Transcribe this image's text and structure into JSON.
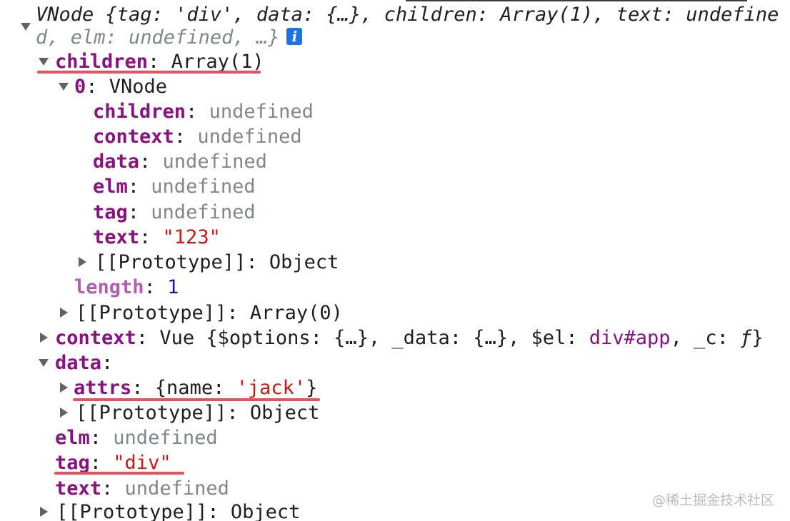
{
  "summary": {
    "line1": "VNode {tag: 'div', data: {…}, children: Array(1), text: undefine",
    "line2": "d, elm: undefined, …}",
    "info_glyph": "i"
  },
  "children": {
    "key": "children",
    "value": "Array(1)",
    "item0": {
      "key": "0",
      "value": "VNode",
      "props": [
        {
          "key": "children",
          "value": "undefined"
        },
        {
          "key": "context",
          "value": "undefined"
        },
        {
          "key": "data",
          "value": "undefined"
        },
        {
          "key": "elm",
          "value": "undefined"
        },
        {
          "key": "tag",
          "value": "undefined"
        },
        {
          "key": "text",
          "value": "\"123\""
        }
      ],
      "proto_key": "[[Prototype]]",
      "proto_value": "Object"
    },
    "length_key": "length",
    "length_value": "1",
    "proto_key": "[[Prototype]]",
    "proto_value": "Array(0)"
  },
  "context": {
    "key": "context",
    "p1": "Vue {$options: {…}, _data: {…}, $el: ",
    "el": "div#app",
    "p2": ", _c: ",
    "fn": "ƒ",
    "p3": "}"
  },
  "data": {
    "key": "data",
    "attrs_key": "attrs",
    "attrs_open": "{name: ",
    "attrs_name": "'jack'",
    "attrs_close": "}",
    "proto_key": "[[Prototype]]",
    "proto_value": "Object"
  },
  "elm": {
    "key": "elm",
    "value": "undefined"
  },
  "tag": {
    "key": "tag",
    "value": "\"div\""
  },
  "text": {
    "key": "text",
    "value": "undefined"
  },
  "root_proto": {
    "key": "[[Prototype]]",
    "value": "Object"
  },
  "watermark": "@稀土掘金技术社区",
  "colors": {
    "key": "#881280",
    "string": "#c41a16",
    "number": "#1a1aa6",
    "muted": "#80868b",
    "underline": "#e8505b",
    "info_badge": "#1a73e8"
  }
}
